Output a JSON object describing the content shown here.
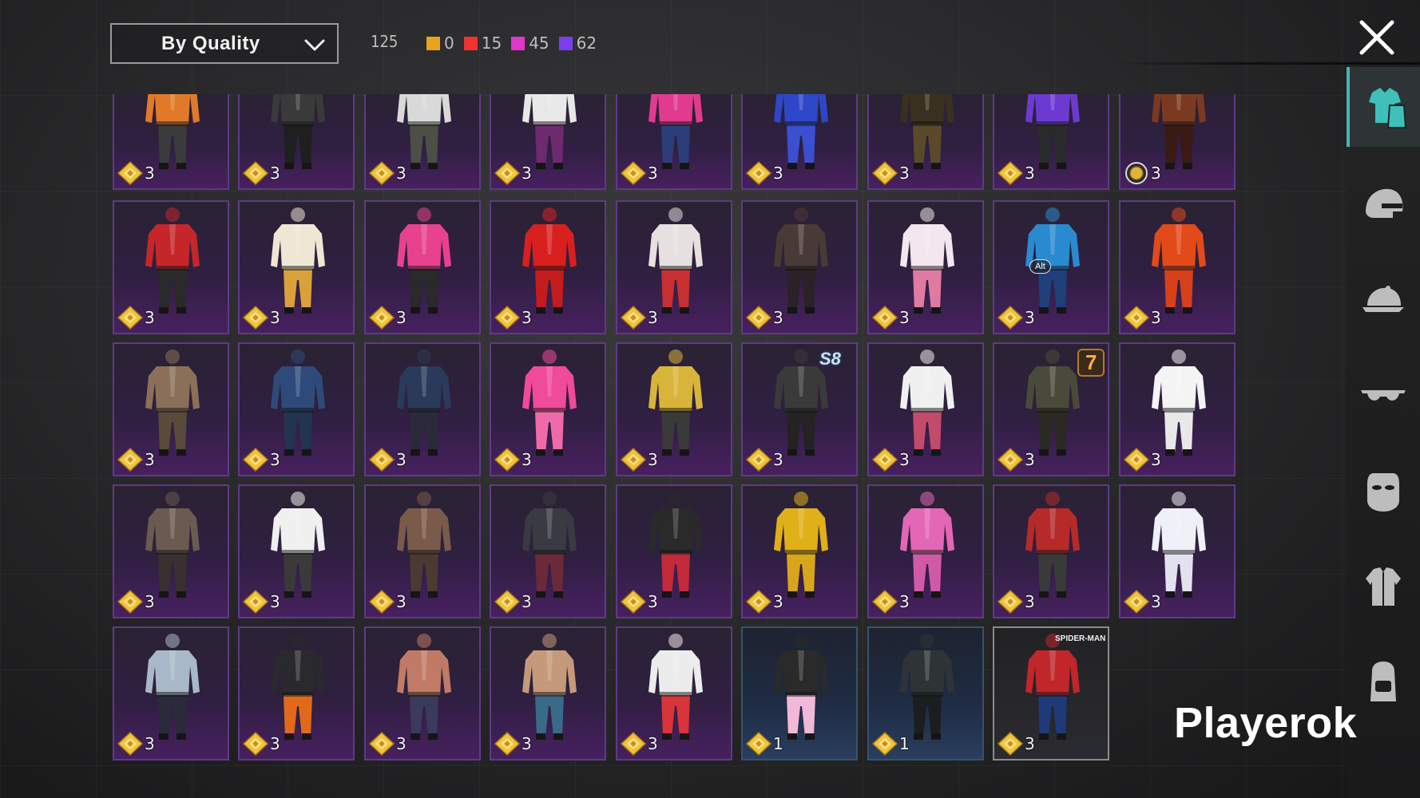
{
  "toolbar": {
    "sort_label": "By Quality",
    "total_count": "125",
    "quality_counts": [
      {
        "name": "orange",
        "color": "#e9a41c",
        "count": "0"
      },
      {
        "name": "red",
        "color": "#ef3432",
        "count": "15"
      },
      {
        "name": "pink",
        "color": "#e236c8",
        "count": "45"
      },
      {
        "name": "purple",
        "color": "#7c3df0",
        "count": "62"
      }
    ]
  },
  "colors": {
    "accent": "#44b7b0",
    "card_purple_border": "#5e3a86",
    "card_blue_border": "#35536f",
    "badge_gold": "#f0c43c"
  },
  "icons": {
    "close": "close-icon",
    "sort_dropdown": "chevron-down-icon",
    "badge": "gold-diamond-icon",
    "badge_alt": "gold-coin-icon"
  },
  "sidebar": {
    "tabs": [
      {
        "name": "outfit-tab",
        "icon": "outfit-icon",
        "active": true
      },
      {
        "name": "helmet-tab",
        "icon": "helmet-icon",
        "active": false
      },
      {
        "name": "cap-tab",
        "icon": "cap-icon",
        "active": false
      },
      {
        "name": "glasses-tab",
        "icon": "glasses-icon",
        "active": false
      },
      {
        "name": "mask-tab",
        "icon": "mask-icon",
        "active": false
      },
      {
        "name": "jacket-tab",
        "icon": "jacket-icon",
        "active": false
      },
      {
        "name": "backpack-tab",
        "icon": "backpack-icon",
        "active": false
      }
    ]
  },
  "items": [
    {
      "qty": "3",
      "badge": "diamond",
      "style": "purple",
      "c1": "#e07a2a",
      "c2": "#3b3b3b"
    },
    {
      "qty": "3",
      "badge": "diamond",
      "style": "purple",
      "c1": "#3a3a3a",
      "c2": "#1f1f1f"
    },
    {
      "qty": "3",
      "badge": "diamond",
      "style": "purple",
      "c1": "#d9d9d9",
      "c2": "#4b4f45"
    },
    {
      "qty": "3",
      "badge": "diamond",
      "style": "purple",
      "c1": "#e8e8e8",
      "c2": "#6e2a6e"
    },
    {
      "qty": "3",
      "badge": "diamond",
      "style": "purple",
      "c1": "#e23a8e",
      "c2": "#2c3e79"
    },
    {
      "qty": "3",
      "badge": "diamond",
      "style": "purple",
      "c1": "#2e46c8",
      "c2": "#3b4fd0"
    },
    {
      "qty": "3",
      "badge": "diamond",
      "style": "purple",
      "c1": "#3a3020",
      "c2": "#5a4a2a"
    },
    {
      "qty": "3",
      "badge": "diamond",
      "style": "purple",
      "c1": "#6c3ad0",
      "c2": "#2a2a2a"
    },
    {
      "qty": "3",
      "badge": "coin",
      "style": "purple",
      "c1": "#7a3a22",
      "c2": "#3a1a14"
    },
    {
      "qty": "3",
      "badge": "diamond",
      "style": "purple",
      "c1": "#c4262a",
      "c2": "#2a2a2a"
    },
    {
      "qty": "3",
      "badge": "diamond",
      "style": "purple",
      "c1": "#efe6d4",
      "c2": "#d9a13a"
    },
    {
      "qty": "3",
      "badge": "diamond",
      "style": "purple",
      "c1": "#e8428e",
      "c2": "#2a2a2a"
    },
    {
      "qty": "3",
      "badge": "diamond",
      "style": "purple",
      "c1": "#d8201f",
      "c2": "#c41c1c"
    },
    {
      "qty": "3",
      "badge": "diamond",
      "style": "purple",
      "c1": "#e7e0e0",
      "c2": "#c63030"
    },
    {
      "qty": "3",
      "badge": "diamond",
      "style": "purple",
      "c1": "#4a3a36",
      "c2": "#2a2226"
    },
    {
      "qty": "3",
      "badge": "diamond",
      "style": "purple",
      "c1": "#f3e6ee",
      "c2": "#e07aa0"
    },
    {
      "qty": "3",
      "badge": "diamond",
      "style": "purple",
      "c1": "#2a8ad0",
      "c2": "#1f3f7a",
      "tag": "Alt"
    },
    {
      "qty": "3",
      "badge": "diamond",
      "style": "purple",
      "c1": "#e24a1a",
      "c2": "#d8401a"
    },
    {
      "qty": "3",
      "badge": "diamond",
      "style": "purple",
      "c1": "#8a7058",
      "c2": "#5a4a3a"
    },
    {
      "qty": "3",
      "badge": "diamond",
      "style": "purple",
      "c1": "#2e4a7a",
      "c2": "#22344e"
    },
    {
      "qty": "3",
      "badge": "diamond",
      "style": "purple",
      "c1": "#2a3a5a",
      "c2": "#2a2a3a"
    },
    {
      "qty": "3",
      "badge": "diamond",
      "style": "purple",
      "c1": "#f04a9a",
      "c2": "#f06aaa"
    },
    {
      "qty": "3",
      "badge": "diamond",
      "style": "purple",
      "c1": "#d9b43a",
      "c2": "#3a3a3a"
    },
    {
      "qty": "3",
      "badge": "diamond",
      "style": "purple",
      "c1": "#3a3a3a",
      "c2": "#232323",
      "tag": "S8"
    },
    {
      "qty": "3",
      "badge": "diamond",
      "style": "purple",
      "c1": "#f0f0f0",
      "c2": "#c24a6a"
    },
    {
      "qty": "3",
      "badge": "diamond",
      "style": "purple",
      "c1": "#4a4a3a",
      "c2": "#2a2a22",
      "tag": "7"
    },
    {
      "qty": "3",
      "badge": "diamond",
      "style": "purple",
      "c1": "#f4f4f4",
      "c2": "#e8e8e8"
    },
    {
      "qty": "3",
      "badge": "diamond",
      "style": "purple",
      "c1": "#6a5a50",
      "c2": "#3a3030"
    },
    {
      "qty": "3",
      "badge": "diamond",
      "style": "purple",
      "c1": "#f0f0f0",
      "c2": "#3a3a3a"
    },
    {
      "qty": "3",
      "badge": "diamond",
      "style": "purple",
      "c1": "#7a5a48",
      "c2": "#4a3a32"
    },
    {
      "qty": "3",
      "badge": "diamond",
      "style": "purple",
      "c1": "#3a3a42",
      "c2": "#6a2a3a"
    },
    {
      "qty": "3",
      "badge": "diamond",
      "style": "purple",
      "c1": "#2a2a2a",
      "c2": "#c22a3a"
    },
    {
      "qty": "3",
      "badge": "diamond",
      "style": "purple",
      "c1": "#e0b018",
      "c2": "#d8a51c"
    },
    {
      "qty": "3",
      "badge": "diamond",
      "style": "purple",
      "c1": "#e466b6",
      "c2": "#d05aa8"
    },
    {
      "qty": "3",
      "badge": "diamond",
      "style": "purple",
      "c1": "#b62a2a",
      "c2": "#3a3a3a"
    },
    {
      "qty": "3",
      "badge": "diamond",
      "style": "purple",
      "c1": "#f0f0f8",
      "c2": "#e2e2ee"
    },
    {
      "qty": "3",
      "badge": "diamond",
      "style": "purple",
      "c1": "#a8b8c8",
      "c2": "#2a2a3a"
    },
    {
      "qty": "3",
      "badge": "diamond",
      "style": "purple",
      "c1": "#2a2a2e",
      "c2": "#e06a1a"
    },
    {
      "qty": "3",
      "badge": "diamond",
      "style": "purple",
      "c1": "#c07a66",
      "c2": "#3a3a5a"
    },
    {
      "qty": "3",
      "badge": "diamond",
      "style": "purple",
      "c1": "#c49a7a",
      "c2": "#3a6a8a"
    },
    {
      "qty": "3",
      "badge": "diamond",
      "style": "purple",
      "c1": "#ececec",
      "c2": "#d8343a"
    },
    {
      "qty": "1",
      "badge": "diamond",
      "style": "blue",
      "c1": "#2a2a2a",
      "c2": "#f2b8d8"
    },
    {
      "qty": "1",
      "badge": "diamond",
      "style": "blue",
      "c1": "#2e3436",
      "c2": "#1a1e1e"
    },
    {
      "qty": "3",
      "badge": "diamond",
      "style": "gray",
      "c1": "#c0262a",
      "c2": "#1e3a7a",
      "tag": "SPIDER-MAN"
    }
  ],
  "watermark": "Playerok"
}
